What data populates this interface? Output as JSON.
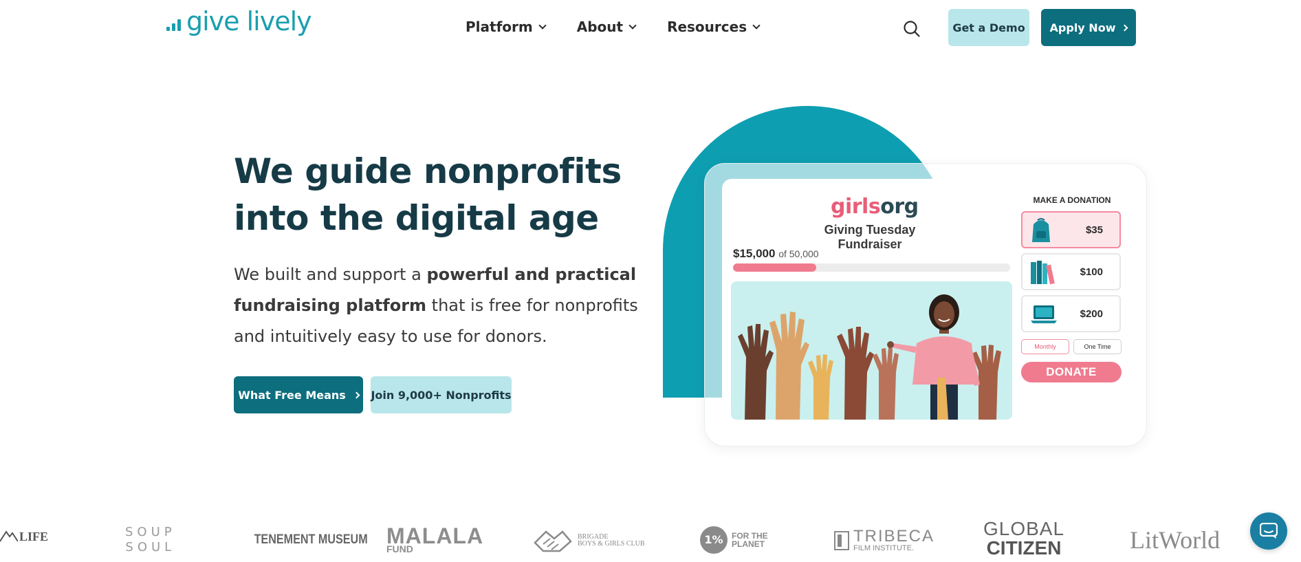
{
  "brand": {
    "name": "give lively",
    "color": "#1a9fae"
  },
  "nav": {
    "items": [
      {
        "label": "Platform"
      },
      {
        "label": "About"
      },
      {
        "label": "Resources"
      }
    ],
    "search_icon": "search-icon",
    "demo_label": "Get a Demo",
    "apply_label": "Apply Now"
  },
  "hero": {
    "title": "We guide nonprofits into the digital age",
    "text_1": "We built and support a ",
    "text_bold": "powerful and practical fundraising platform",
    "text_2": " that is free for nonprofits and intuitively easy to use for donors.",
    "primary_button": "What Free Means",
    "secondary_button": "Join 9,000+ Nonprofits"
  },
  "illustration": {
    "org_name_part1": "girls",
    "org_name_part2": "org",
    "fundraiser_title": "Giving Tuesday Fundraiser",
    "raised": "$15,000",
    "goal_text": "of 50,000",
    "progress_fraction": 0.3,
    "donation_header": "MAKE A DONATION",
    "amounts": [
      {
        "value": "$35",
        "icon": "backpack-icon",
        "selected": true
      },
      {
        "value": "$100",
        "icon": "books-icon",
        "selected": false
      },
      {
        "value": "$200",
        "icon": "laptop-icon",
        "selected": false
      }
    ],
    "frequency": {
      "monthly": "Monthly",
      "one_time": "One Time"
    },
    "donate_label": "DONATE"
  },
  "partners": {
    "life": "LIFE",
    "soup_soul_1": "SOUP",
    "soup_soul_2": "SOUL",
    "tenement": "TENEMENT MUSEUM",
    "malala_1": "MALALA",
    "malala_2": "FUND",
    "brigade_1": "BRIGADE",
    "brigade_2": "BOYS & GIRLS CLUB",
    "planet_1": "FOR THE",
    "planet_2": "PLANET",
    "planet_num": "1%",
    "tribeca_1": "TRIBECA",
    "tribeca_2": "FILM INSTITUTE.",
    "global_1": "GLOBAL",
    "global_2": "CITIZEN",
    "litworld": "LitWorld"
  },
  "chat": {
    "icon": "chat-icon"
  },
  "colors": {
    "primary": "#0d6e7e",
    "light": "#b8e6ea",
    "heading": "#163b47",
    "accent_pink": "#f07b8f",
    "arch": "#0e9eb1"
  }
}
